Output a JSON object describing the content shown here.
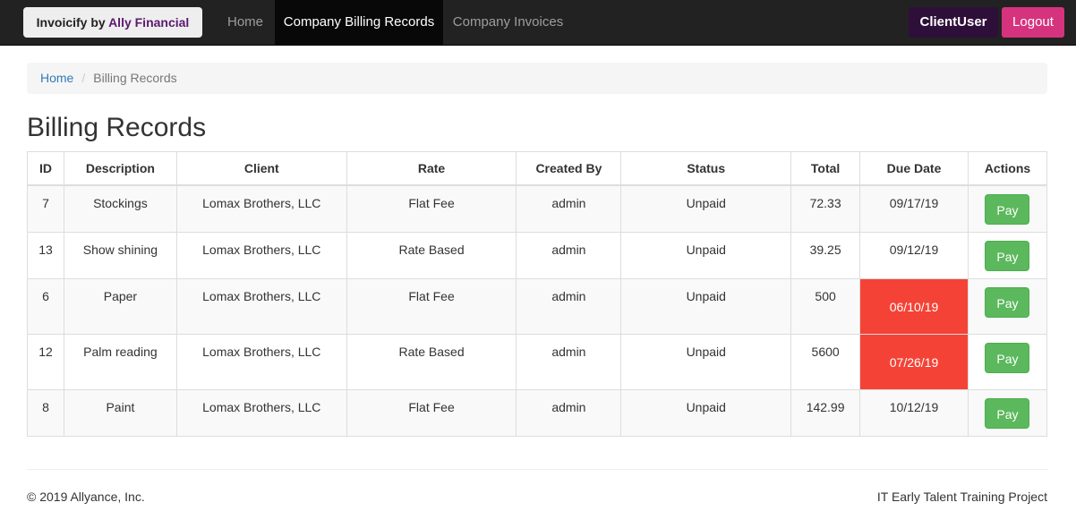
{
  "navbar": {
    "brand_prefix": "Invoicify by ",
    "brand_accent": "Ally Financial",
    "links": [
      {
        "label": "Home"
      },
      {
        "label": "Company Billing Records"
      },
      {
        "label": "Company Invoices"
      }
    ],
    "user_label": "ClientUser",
    "logout_label": "Logout"
  },
  "breadcrumb": {
    "home": "Home",
    "separator": "/",
    "current": "Billing Records"
  },
  "page_title": "Billing Records",
  "table": {
    "headers": [
      "ID",
      "Description",
      "Client",
      "Rate",
      "Created By",
      "Status",
      "Total",
      "Due Date",
      "Actions"
    ],
    "rows": [
      {
        "id": "7",
        "description": "Stockings",
        "client": "Lomax Brothers, LLC",
        "rate": "Flat Fee",
        "created_by": "admin",
        "status": "Unpaid",
        "total": "72.33",
        "due_date": "09/17/19",
        "overdue": false,
        "action": "Pay"
      },
      {
        "id": "13",
        "description": "Show shining",
        "client": "Lomax Brothers, LLC",
        "rate": "Rate Based",
        "created_by": "admin",
        "status": "Unpaid",
        "total": "39.25",
        "due_date": "09/12/19",
        "overdue": false,
        "action": "Pay"
      },
      {
        "id": "6",
        "description": "Paper",
        "client": "Lomax Brothers, LLC",
        "rate": "Flat Fee",
        "created_by": "admin",
        "status": "Unpaid",
        "total": "500",
        "due_date": "06/10/19",
        "overdue": true,
        "action": "Pay"
      },
      {
        "id": "12",
        "description": "Palm reading",
        "client": "Lomax Brothers, LLC",
        "rate": "Rate Based",
        "created_by": "admin",
        "status": "Unpaid",
        "total": "5600",
        "due_date": "07/26/19",
        "overdue": true,
        "action": "Pay"
      },
      {
        "id": "8",
        "description": "Paint",
        "client": "Lomax Brothers, LLC",
        "rate": "Flat Fee",
        "created_by": "admin",
        "status": "Unpaid",
        "total": "142.99",
        "due_date": "10/12/19",
        "overdue": false,
        "action": "Pay"
      }
    ]
  },
  "footer": {
    "copyright": "© 2019 Allyance, Inc.",
    "project": "IT Early Talent Training Project"
  },
  "colors": {
    "navbar_bg": "#222222",
    "active_nav_bg": "#080808",
    "user_bg": "#2e0f3a",
    "logout_bg": "#d6337e",
    "overdue_bg": "#f44336",
    "pay_button_bg": "#5cb85c",
    "link": "#337ab7"
  }
}
